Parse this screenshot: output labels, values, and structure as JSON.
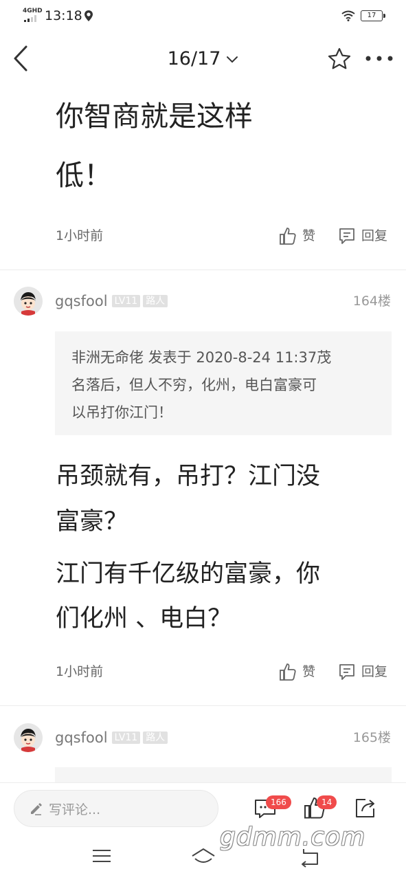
{
  "status_bar": {
    "network": "4GHD",
    "time": "13:18",
    "battery": "17"
  },
  "nav": {
    "page_indicator": "16/17"
  },
  "post_top": {
    "text_line1": "你智商就是这样",
    "text_line2": "低！",
    "time": "1小时前",
    "like_label": "赞",
    "reply_label": "回复"
  },
  "reply_164": {
    "username": "gqsfool",
    "level": "LV11",
    "role": "路人",
    "floor": "164楼",
    "quote_line1": "非洲无命佬 发表于 2020-8-24 11:37茂",
    "quote_line2": "名落后，但人不穷，化州，电白富豪可",
    "quote_line3": "以吊打你江门！",
    "body_line1": "吊颈就有，吊打？江门没",
    "body_line2": "富豪？",
    "body_line3": "江门有千亿级的富豪，你",
    "body_line4": "们化州 、电白？",
    "time": "1小时前",
    "like_label": "赞",
    "reply_label": "回复"
  },
  "reply_165": {
    "username": "gqsfool",
    "level": "LV11",
    "role": "路人",
    "floor": "165楼"
  },
  "comment_bar": {
    "placeholder": "写评论...",
    "comment_count": "166",
    "like_count": "14"
  },
  "watermark": "gdmm.com",
  "colors": {
    "badge_red": "#f04b4b",
    "text_main": "#222222",
    "text_meta": "#666666",
    "quote_bg": "#f5f5f5"
  }
}
